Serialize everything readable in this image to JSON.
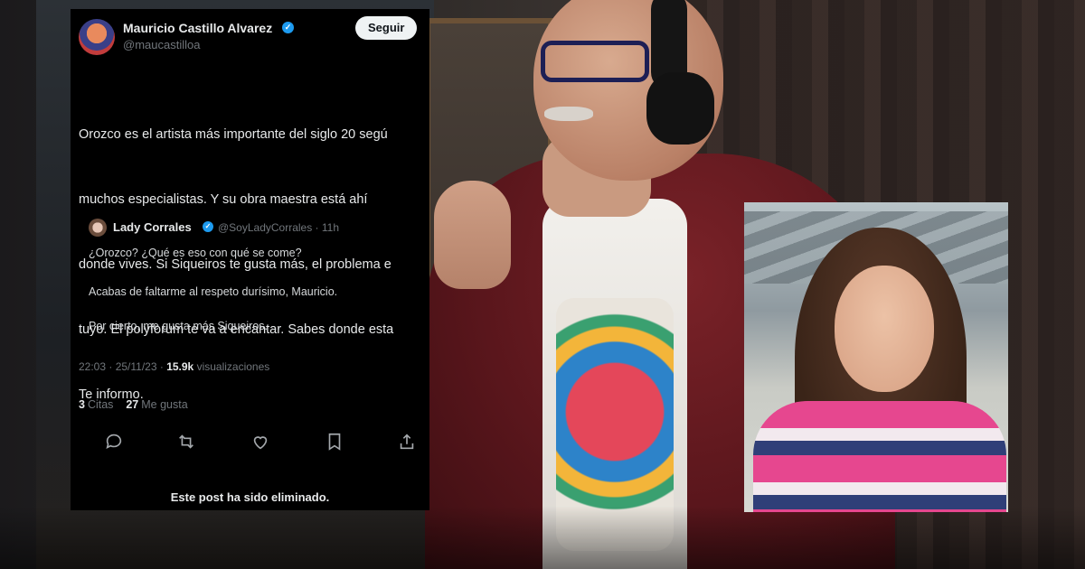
{
  "tweet": {
    "author_name": "Mauricio Castillo Alvarez",
    "author_handle": "@maucastilloa",
    "follow_label": "Seguir",
    "body_lines": [
      "Orozco es el artista más importante del siglo 20 segú",
      "muchos especialistas. Y su obra maestra está ahí",
      "donde vives. Si Siqueiros te gusta más, el problema e",
      "tuyo. El polyforum te va a encantar. Sabes donde esta",
      "Te informo."
    ],
    "quote": {
      "name": "Lady Corrales",
      "handle_time": "@SoyLadyCorrales · 11h",
      "lines": [
        "¿Orozco? ¿Qué es eso con qué se come?",
        "Acabas de faltarme al respeto durísimo, Mauricio.",
        "Por cierto, me gusta más Siqueiros. ..."
      ]
    },
    "timestamp": "22:03 · 25/11/23 ·",
    "views_count": "15.9k",
    "views_label": "visualizaciones",
    "quotes_count": "3",
    "quotes_label": "Citas",
    "likes_count": "27",
    "likes_label": "Me gusta",
    "actions": [
      "reply-icon",
      "retweet-icon",
      "like-icon",
      "bookmark-icon",
      "share-icon"
    ],
    "deleted_notice": "Este post ha sido eliminado."
  },
  "colors": {
    "card_bg": "#000000",
    "verified": "#1d9bf0",
    "secondary_text": "#71767b"
  }
}
